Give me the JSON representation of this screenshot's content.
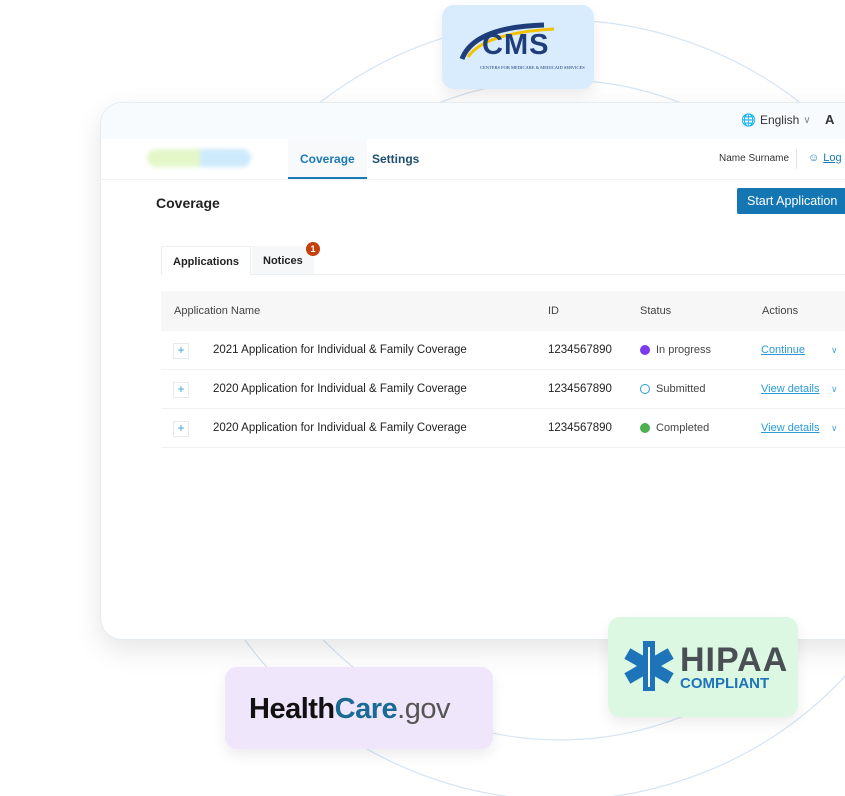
{
  "logos": {
    "cms": {
      "title": "CMS",
      "subtitle": "CENTERS FOR MEDICARE & MEDICAID SERVICES"
    },
    "healthcare": {
      "part1": "Health",
      "part2": "Care",
      "part3": ".gov"
    },
    "hipaa": {
      "title": "HIPAA",
      "subtitle": "COMPLIANT"
    }
  },
  "topbar": {
    "language": "English",
    "font_size_label": "A"
  },
  "nav": {
    "tabs": [
      {
        "label": "Coverage",
        "active": true
      },
      {
        "label": "Settings",
        "active": false
      }
    ],
    "user_name": "Name Surname",
    "logout_label": "Log"
  },
  "page": {
    "title": "Coverage",
    "start_button": "Start Application"
  },
  "subtabs": {
    "applications": "Applications",
    "notices": "Notices",
    "notices_badge": "1"
  },
  "table": {
    "headers": {
      "name": "Application Name",
      "id": "ID",
      "status": "Status",
      "actions": "Actions"
    },
    "rows": [
      {
        "name": "2021 Application for Individual & Family Coverage",
        "id": "1234567890",
        "status": "In progress",
        "action": "Continue"
      },
      {
        "name": "2020 Application for Individual & Family Coverage",
        "id": "1234567890",
        "status": "Submitted",
        "action": "View details"
      },
      {
        "name": "2020 Application for Individual & Family Coverage",
        "id": "1234567890",
        "status": "Completed",
        "action": "View details"
      }
    ]
  },
  "colors": {
    "primary": "#1576b4",
    "in_progress": "#7c3aed",
    "submitted": "#2a9ad8",
    "completed": "#4caf50",
    "badge": "#c2410c"
  }
}
